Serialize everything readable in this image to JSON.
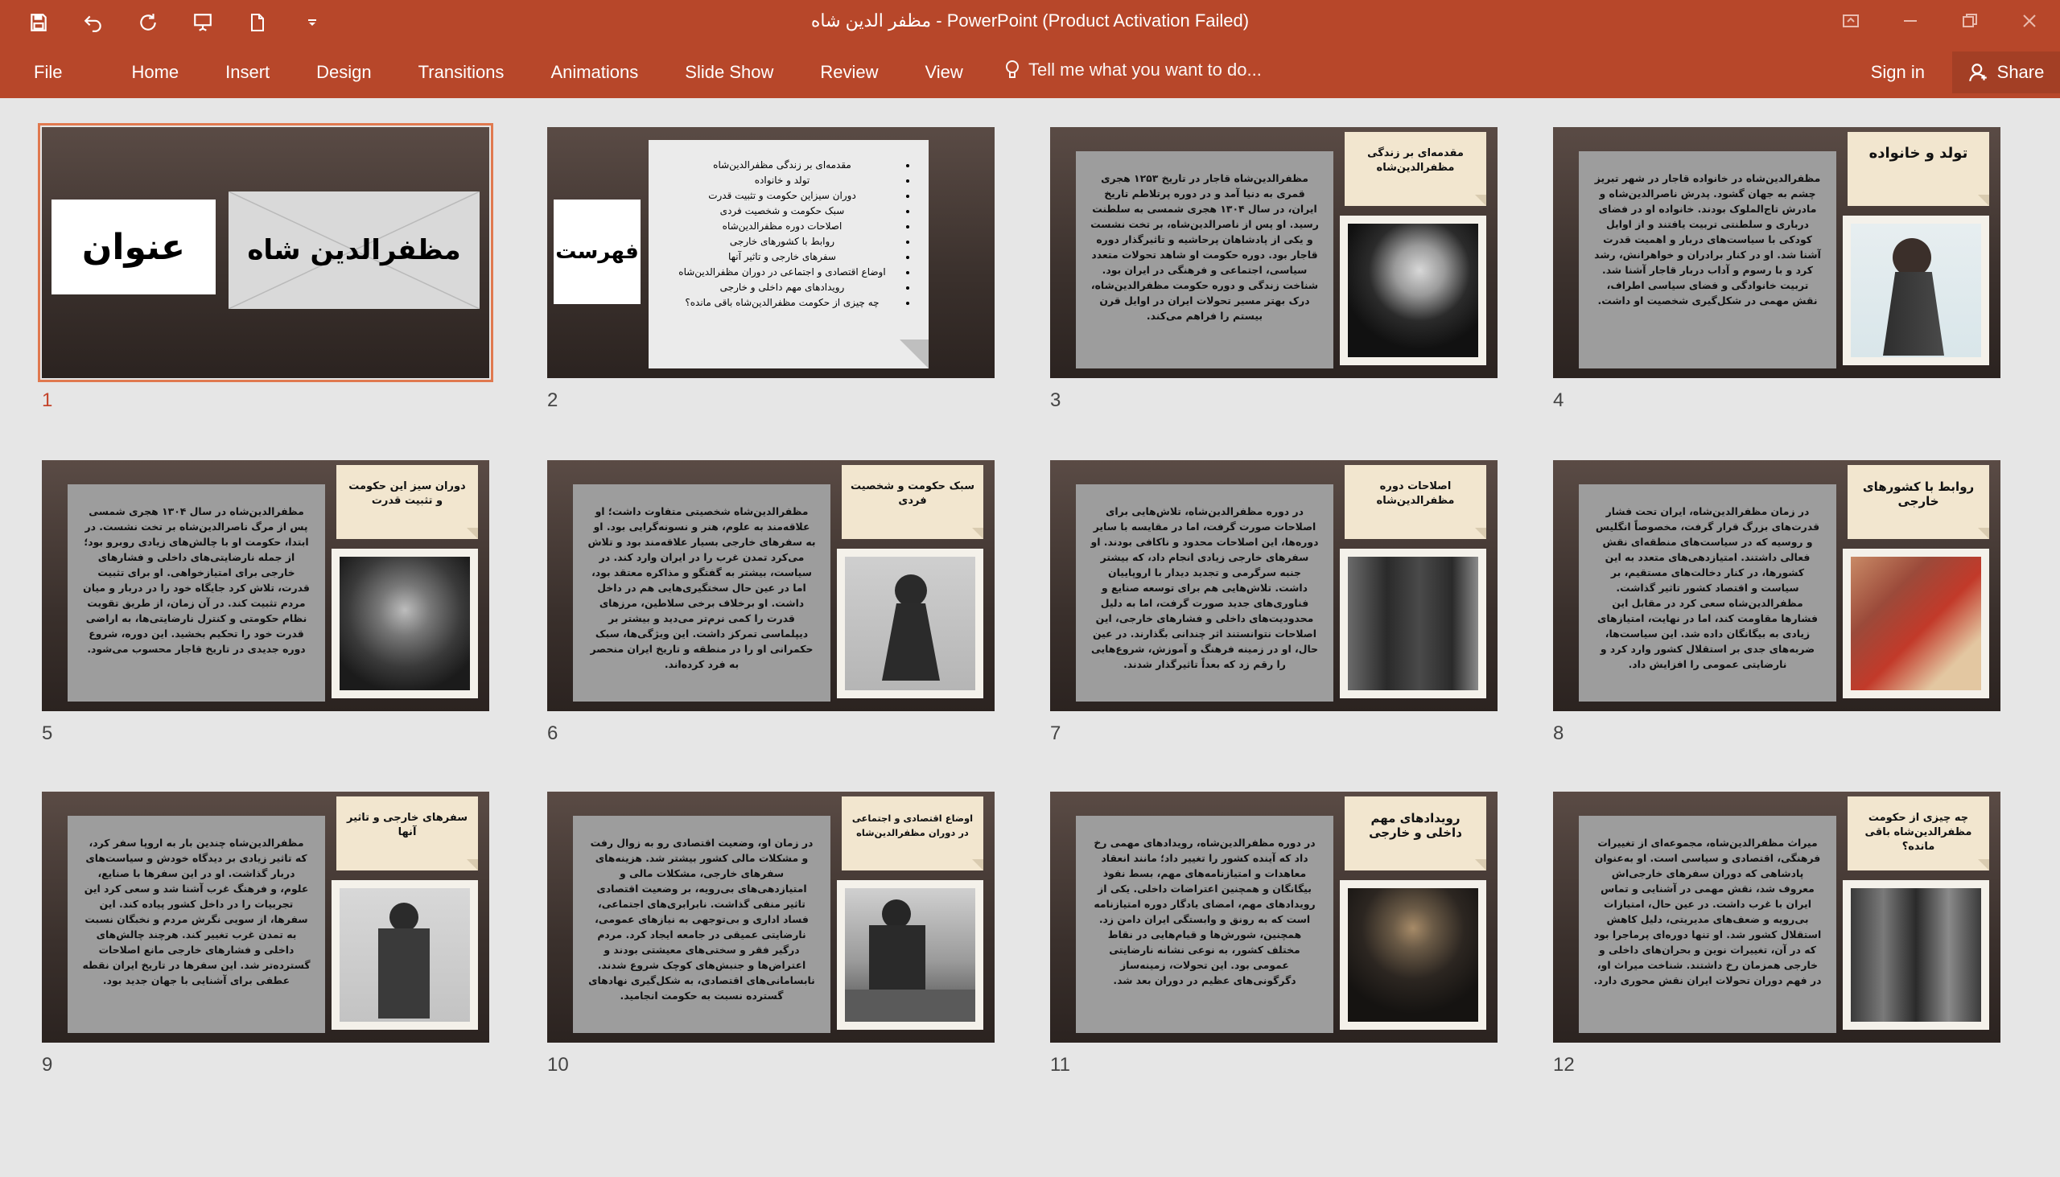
{
  "window": {
    "title": "مظفر الدین شاه - PowerPoint (Product Activation Failed)"
  },
  "ribbon": {
    "tabs": [
      "File",
      "Home",
      "Insert",
      "Design",
      "Transitions",
      "Animations",
      "Slide Show",
      "Review",
      "View"
    ],
    "tell_me": "Tell me what you want to do...",
    "sign_in": "Sign in",
    "share": "Share"
  },
  "slides": [
    {
      "num": "1",
      "left": "عنوان",
      "right": "مظفرالدین شاه"
    },
    {
      "num": "2",
      "left": "فهرست",
      "items": [
        "مقدمه‌ای بر زندگی مظفرالدین‌شاه",
        "تولد و خانواده",
        "دوران سیزاین حکومت و تثبیت قدرت",
        "سبک حکومت و شخصیت فردی",
        "اصلاحات دوره مظفرالدین‌شاه",
        "روابط با کشورهای خارجی",
        "سفرهای خارجی و تاثیر آنها",
        "اوضاع اقتصادی و اجتماعی در دوران مظفرالدین‌شاه",
        "رویدادهای مهم داخلی و خارجی",
        "چه چیزی از حکومت مظفرالدین‌شاه باقی مانده؟"
      ]
    },
    {
      "num": "3",
      "note": "مقدمه‌ای بر زندگی مظفرالدین‌شاه",
      "text": "مظفرالدین‌شاه قاجار در تاریخ ۱۲۵۳ هجری قمری به دنیا آمد و در دوره پرتلاطم تاریخ ایران، در سال ۱۳۰۴ هجری شمسی به سلطنت رسید. او پس از ناصرالدین‌شاه، بر تخت نشست و یکی از پادشاهان پرحاشیه و تاثیرگذار دوره قاجار بود. دوره حکومت او شاهد تحولات متعدد سیاسی، اجتماعی و فرهنگی در ایران بود. شناخت زندگی و دوره حکومت مظفرالدین‌شاه، درک بهتر مسیر تحولات ایران در اوایل قرن بیستم را فراهم می‌کند."
    },
    {
      "num": "4",
      "note": "تولد و خانواده",
      "text": "مظفرالدین‌شاه در خانواده قاجار در شهر تبریز چشم به جهان گشود. پدرش ناصرالدین‌شاه و مادرش تاج‌الملوک بودند. خانواده او در فضای درباری و سلطنتی تربیت یافتند و از اوایل کودکی با سیاست‌های دربار و اهمیت قدرت آشنا شد. او در کنار برادران و خواهرانش، رشد کرد و با رسوم و آداب دربار قاجار آشنا شد. تربیت خانوادگی و فضای سیاسی اطراف، نقش مهمی در شکل‌گیری شخصیت او داشت."
    },
    {
      "num": "5",
      "note": "دوران سیز این حکومت و تثبیت قدرت",
      "text": "مظفرالدین‌شاه در سال ۱۳۰۴ هجری شمسی پس از مرگ ناصرالدین‌شاه بر تخت نشست. در ابتدا، حکومت او با چالش‌های زیادی روبرو بود؛ از جمله نارضایتی‌های داخلی و فشارهای خارجی برای امتیازخواهی. او برای تثبیت قدرت، تلاش کرد جایگاه خود را در دربار و میان مردم تثبیت کند. در آن زمان، از طریق تقویت نظام حکومتی و کنترل نارضایتی‌ها، به اراضی قدرت خود را تحکیم بخشید. این دوره، شروع دوره جدیدی در تاریخ قاجار محسوب می‌شود."
    },
    {
      "num": "6",
      "note": "سبک حکومت و شخصیت فردی",
      "text": "مظفرالدین‌شاه شخصیتی متفاوت داشت؛ او علاقه‌مند به علوم، هنر و نسونه‌گرایی بود. او به سفرهای خارجی بسیار علاقه‌مند بود و تلاش می‌کرد تمدن غرب را در ایران وارد کند. در سیاست، بیشتر به گفتگو و مذاکره معتقد بود، اما در عین حال سختگیری‌هایی هم در داخل داشت. او برخلاف برخی سلاطین، مرزهای قدرت را کمی نرم‌تر می‌دید و بیشتر بر دیپلماسی تمرکز داشت. این ویژگی‌ها، سبک حکمرانی او را در منطقه و تاریخ ایران منحصر به فرد کرده‌اند."
    },
    {
      "num": "7",
      "note": "اصلاحات دوره مظفرالدین‌شاه",
      "text": "در دوره مظفرالدین‌شاه، تلاش‌هایی برای اصلاحات صورت گرفت، اما در مقایسه با سایر دوره‌ها، این اصلاحات محدود و ناکافی بودند. او سفرهای خارجی زیادی انجام داد، که بیشتر جنبه سرگرمی و تجدید دیدار با اروپاییان داشت. تلاش‌هایی هم برای توسعه صنایع و فناوری‌های جدید صورت گرفت، اما به دلیل محدودیت‌های داخلی و فشارهای خارجی، این اصلاحات نتوانستند اثر چندانی بگذارند. در عین حال، او در زمینه فرهنگ و آموزش، شروع‌هایی را رقم زد که بعداً تاثیرگذار شدند."
    },
    {
      "num": "8",
      "note": "روابط با کشورهای خارجی",
      "text": "در زمان مظفرالدین‌شاه، ایران تحت فشار قدرت‌های بزرگ قرار گرفت، مخصوصاً انگلیس و روسیه که در سیاست‌های منطقه‌ای نقش فعالی داشتند. امتیازدهی‌های متعدد به این کشورها، در کنار دخالت‌های مستقیم، بر سیاست و اقتصاد کشور تاثیر گذاشت. مظفرالدین‌شاه سعی کرد در مقابل این فشارها مقاومت کند، اما در نهایت، امتیازهای زیادی به بیگانگان داده شد. این سیاست‌ها، ضربه‌های جدی بر استقلال کشور وارد کرد و نارضایتی عمومی را افزایش داد."
    },
    {
      "num": "9",
      "note": "سفرهای خارجی و تاثیر آنها",
      "text": "مظفرالدین‌شاه چندین بار به اروپا سفر کرد، که تاثیر زیادی بر دیدگاه خودش و سیاست‌های دربار گذاشت. او در این سفرها با صنایع، علوم، و فرهنگ غرب آشنا شد و سعی کرد این تجربیات را در داخل کشور پیاده کند. این سفرها، از سویی نگرش مردم و نخبگان نسبت به تمدن غرب تغییر کند. هرچند چالش‌های داخلی و فشارهای خارجی مانع اصلاحات گسترده‌تر شد. این سفرها در تاریخ ایران نقطه عطفی برای آشنایی با جهان جدید بود."
    },
    {
      "num": "10",
      "note": "اوضاع اقتصادی و اجتماعی در دوران مظفرالدین‌شاه",
      "text": "در زمان او، وضعیت اقتصادی رو به زوال رفت و مشکلات مالی کشور بیشتر شد. هزینه‌های سفرهای خارجی، مشکلات مالی و امتیازدهی‌های بی‌رویه، بر وضعیت اقتصادی تاثیر منفی گذاشت. نابرابری‌های اجتماعی، فساد اداری و بی‌توجهی به نیازهای عمومی، نارضایتی عمیقی در جامعه ایجاد کرد. مردم درگیر فقر و سختی‌های معیشتی بودند و اعتراض‌ها و جنبش‌های کوچک شروع شدند. نابسامانی‌های اقتصادی، به شکل‌گیری نهادهای گسترده نسبت به حکومت انجامید."
    },
    {
      "num": "11",
      "note": "رویدادهای مهم داخلی و خارجی",
      "text": "در دوره مظفرالدین‌شاه، رویدادهای مهمی رخ داد که آینده کشور را تغییر داد؛ مانند انعقاد معاهدات و امتیازنامه‌های مهم، بسط نفوذ بیگانگان و همچنین اعتراضات داخلی. یکی از رویدادهای مهم، امضای یادگار دوره امتیازنامه است که به رونق و وابستگی ایران دامن زد. همچنین، شورش‌ها و قیام‌هایی در نقاط مختلف کشور، به نوعی نشانه نارضایتی عمومی بود. این تحولات، زمینه‌ساز دگرگونی‌های عظیم در دوران بعد شد."
    },
    {
      "num": "12",
      "note": "چه چیزی از حکومت مظفرالدین‌شاه باقی مانده؟",
      "text": "میراث مظفرالدین‌شاه، مجموعه‌ای از تغییرات فرهنگی، اقتصادی و سیاسی است. او به‌عنوان پادشاهی که دوران سفرهای خارجی‌اش معروف شد، نقش مهمی در آشنایی و تماس ایران با غرب داشت. در عین حال، امتیازات بی‌رویه و ضعف‌های مدیریتی، دلیل کاهش استقلال کشور شد. او تنها دوره‌ای پرماجرا بود که در آن، تغییرات نوین و بحران‌های داخلی و خارجی همزمان رخ داشتند. شناخت میراث او، در فهم دوران تحولات ایران نقش محوری دارد."
    }
  ]
}
